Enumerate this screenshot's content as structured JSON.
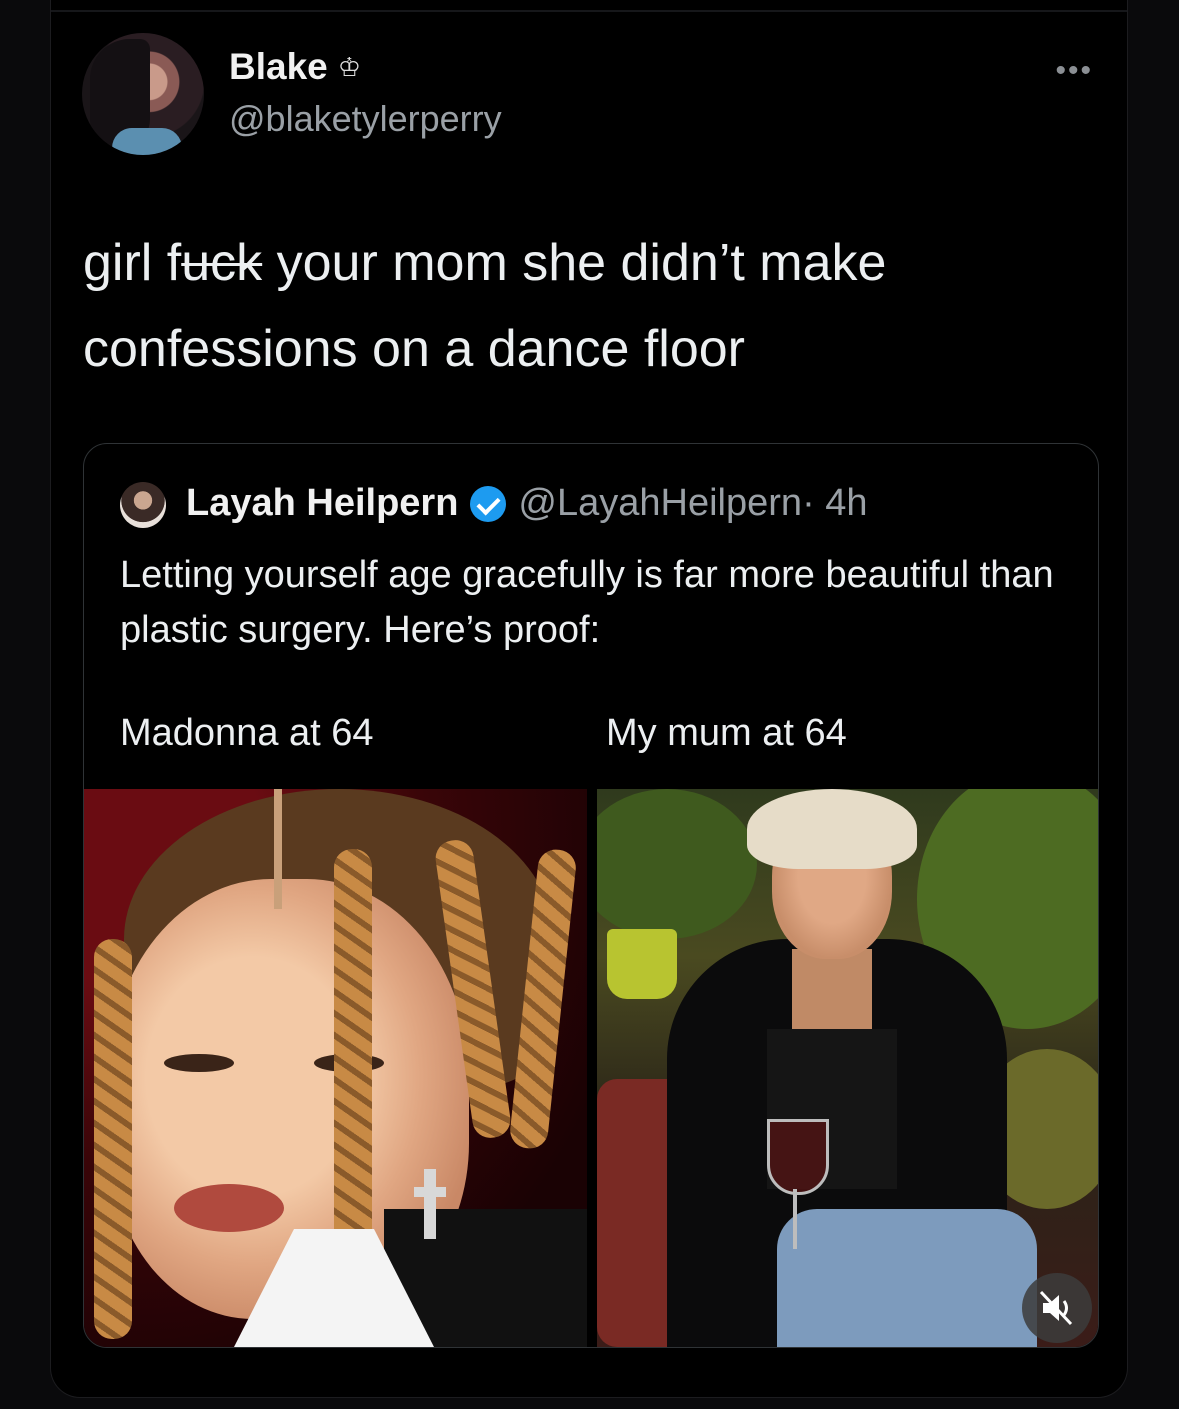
{
  "author": {
    "name": "Blake",
    "badge_glyph": "♔",
    "handle": "@blaketylerperry"
  },
  "more_glyph": "•••",
  "tweet": {
    "text_pre": "girl f",
    "text_censored": "uck",
    "text_post_line1": " your mom she didn’t make",
    "text_line2": "confessions on a dance floor"
  },
  "quoted": {
    "name": "Layah Heilpern",
    "handle": "@LayahHeilpern",
    "time": " · 4h",
    "text": "Letting yourself age gracefully is far more beautiful than plastic surgery. Here’s proof:",
    "caption_left": "Madonna at 64",
    "caption_right": "My mum at 64"
  },
  "colors": {
    "verified": "#1d9bf0",
    "background": "#000000"
  },
  "icons": [
    "crown-icon",
    "more-options-icon",
    "verified-badge-icon",
    "muted-speaker-icon"
  ]
}
